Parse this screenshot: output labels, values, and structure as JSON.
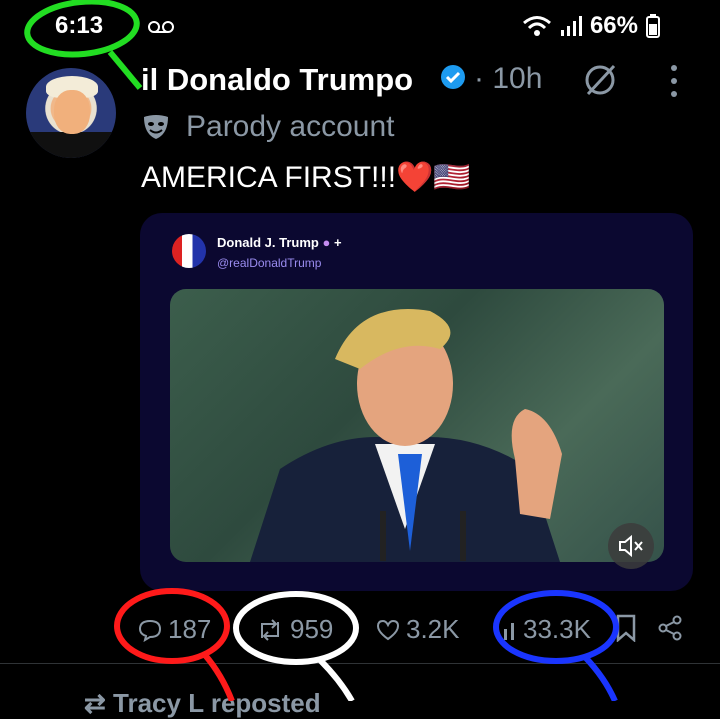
{
  "status_bar": {
    "time": "6:13",
    "battery": "66%",
    "icons": [
      "voicemail-icon",
      "wifi-icon",
      "signal-icon",
      "battery-icon"
    ]
  },
  "post": {
    "author_name": "il Donaldo Trumpo",
    "time_ago": "10h",
    "parody_label": "Parody account",
    "text": "AMERICA FIRST!!!❤️🇺🇸",
    "embedded": {
      "author_name": "Donald J. Trump",
      "handle": "@realDonaldTrump"
    },
    "stats": {
      "replies": "187",
      "reposts": "959",
      "likes": "3.2K",
      "views": "33.3K"
    }
  },
  "next_item": {
    "repost_text": "Tracy L reposted"
  },
  "colors": {
    "background": "#000000",
    "verified": "#1d9bf0",
    "muted_text": "#8b98a5",
    "card_bg": "#0b0830",
    "annot_green": "#22dd22",
    "annot_red": "#ff1a1a",
    "annot_white": "#ffffff",
    "annot_blue": "#1a35ff"
  }
}
